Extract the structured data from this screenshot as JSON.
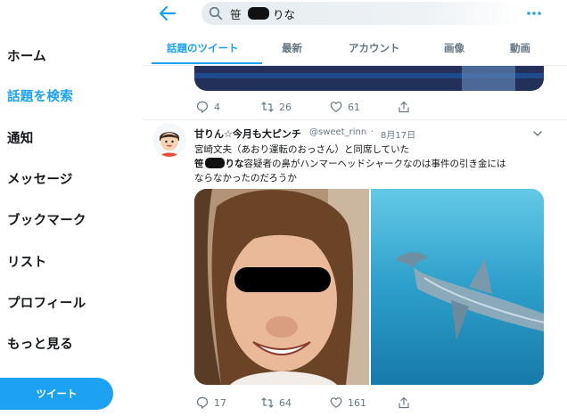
{
  "sidebar": {
    "items": [
      {
        "label": "ホーム",
        "active": false
      },
      {
        "label": "話題を検索",
        "active": true
      },
      {
        "label": "通知",
        "active": false
      },
      {
        "label": "メッセージ",
        "active": false
      },
      {
        "label": "ブックマーク",
        "active": false
      },
      {
        "label": "リスト",
        "active": false
      },
      {
        "label": "プロフィール",
        "active": false
      },
      {
        "label": "もっと見る",
        "active": false
      }
    ],
    "tweet_button": "ツイート"
  },
  "search": {
    "query_prefix": "笹",
    "query_suffix": "りな"
  },
  "tabs": [
    {
      "label": "話題のツイート",
      "active": true
    },
    {
      "label": "最新",
      "active": false
    },
    {
      "label": "アカウント",
      "active": false
    },
    {
      "label": "画像",
      "active": false
    },
    {
      "label": "動画",
      "active": false
    }
  ],
  "previous_tweet": {
    "replies": "4",
    "retweets": "26",
    "likes": "61"
  },
  "tweet": {
    "display_name": "甘りん☆今月も大ピンチ",
    "handle": "@sweet_rinn",
    "dot": "·",
    "date": "8月17日",
    "line1": "宮崎文夫（あおり運転のおっさん）と同席していた",
    "line2_prefix": "笹",
    "line2_bold_suffix": "りな",
    "line2_rest": "容疑者の鼻がハンマーヘッドシャークなのは事件の引き金には",
    "line3": "ならなかったのだろうか",
    "replies": "17",
    "retweets": "64",
    "likes": "161"
  },
  "colors": {
    "accent": "#1da1f2",
    "text": "#14171a",
    "muted": "#657786"
  }
}
